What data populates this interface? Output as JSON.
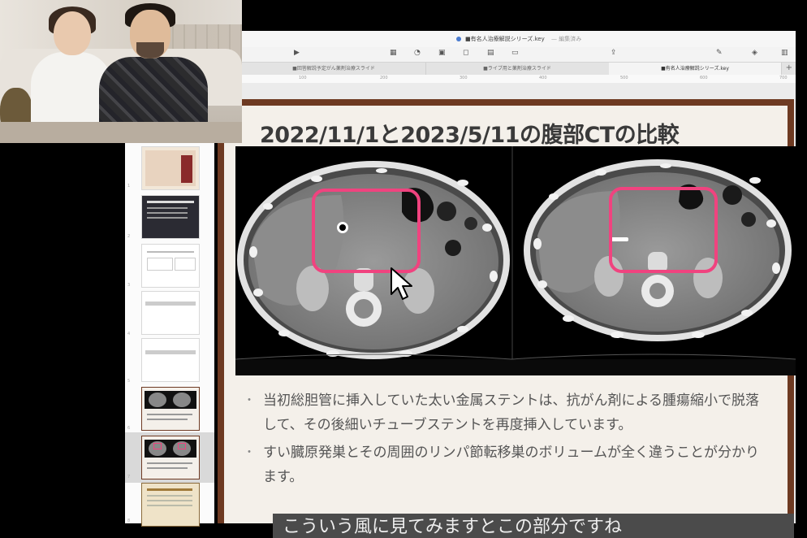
{
  "window": {
    "title": "■有名人治療解説シリーズ.key",
    "status": "— 編集済み"
  },
  "tabs": [
    {
      "label": "■回答解説予定がん薬剤治療スライド",
      "active": false
    },
    {
      "label": "■ライブ用と薬剤治療スライド",
      "active": false
    },
    {
      "label": "■有名人治療解説シリーズ.key",
      "active": true
    }
  ],
  "ruler": [
    "100",
    "200",
    "300",
    "400",
    "500",
    "600",
    "700"
  ],
  "slide": {
    "title": "2022/11/1と2023/5/11の腹部CTの比較",
    "bullets": [
      "当初総胆管に挿入していた太い金属ステントは、抗がん剤による腫瘍縮小で脱落して、その後細いチューブステントを再度挿入しています。",
      "すい臓原発巣とその周囲のリンパ節転移巣のボリュームが全く違うことが分かります。"
    ],
    "caption": "こういう風に見てみますとこの部分ですね"
  },
  "thumbnails": [
    {
      "num": "1"
    },
    {
      "num": "2"
    },
    {
      "num": "3"
    },
    {
      "num": "4"
    },
    {
      "num": "5"
    },
    {
      "num": "6"
    },
    {
      "num": "7"
    },
    {
      "num": "8"
    }
  ],
  "colors": {
    "slide_border": "#6e3a22",
    "highlight_box": "#f0437f",
    "caption_bg": "#4b4b4b"
  },
  "icons": [
    "play-icon",
    "table-icon",
    "chart-icon",
    "text-icon",
    "shape-icon",
    "media-icon",
    "comment-icon",
    "share-icon",
    "format-icon",
    "animate-icon",
    "document-icon"
  ]
}
